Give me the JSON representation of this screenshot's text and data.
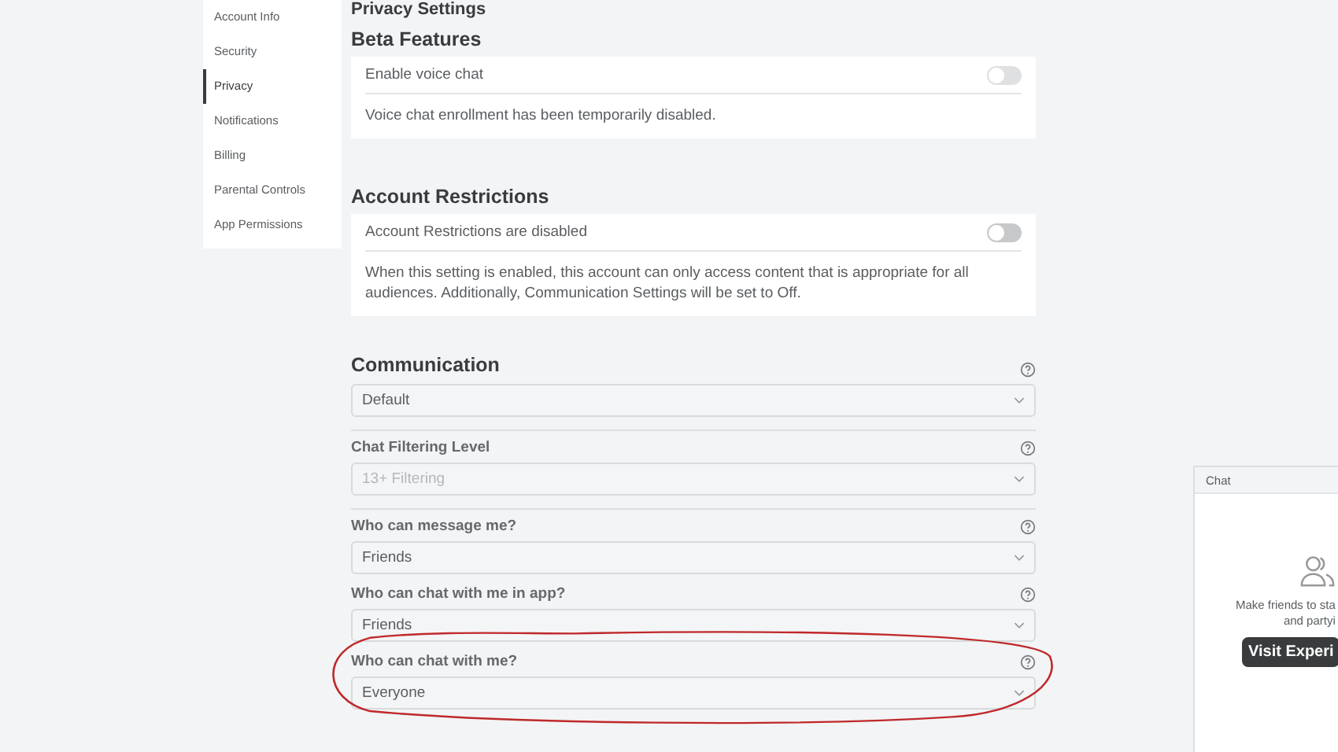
{
  "sidebar": {
    "items": [
      {
        "label": "Account Info",
        "selected": false
      },
      {
        "label": "Security",
        "selected": false
      },
      {
        "label": "Privacy",
        "selected": true
      },
      {
        "label": "Notifications",
        "selected": false
      },
      {
        "label": "Billing",
        "selected": false
      },
      {
        "label": "Parental Controls",
        "selected": false
      },
      {
        "label": "App Permissions",
        "selected": false
      }
    ]
  },
  "page_title": "Privacy Settings",
  "beta_features": {
    "heading": "Beta Features",
    "toggle": {
      "label": "Enable voice chat",
      "on": false,
      "disabled": true
    },
    "note": "Voice chat enrollment has been temporarily disabled."
  },
  "account_restrictions": {
    "heading": "Account Restrictions",
    "toggle": {
      "label": "Account Restrictions are disabled",
      "on": false,
      "disabled": false
    },
    "note": "When this setting is enabled, this account can only access content that is appropriate for all audiences. Additionally, Communication Settings will be set to Off."
  },
  "communication": {
    "heading": "Communication",
    "preset": {
      "value": "Default",
      "disabled": false
    },
    "groups": [
      {
        "fields": [
          {
            "label": "Chat Filtering Level",
            "value": "13+ Filtering",
            "disabled": true,
            "circled": false
          }
        ]
      },
      {
        "fields": [
          {
            "label": "Who can message me?",
            "value": "Friends",
            "disabled": false,
            "circled": false
          },
          {
            "label": "Who can chat with me in app?",
            "value": "Friends",
            "disabled": false,
            "circled": false
          },
          {
            "label": "Who can chat with me?",
            "value": "Everyone",
            "disabled": false,
            "circled": true
          }
        ]
      }
    ]
  },
  "chat_panel": {
    "title": "Chat",
    "message_lines": [
      "Make friends to sta",
      "and partyi"
    ],
    "button": "Visit Experi"
  }
}
